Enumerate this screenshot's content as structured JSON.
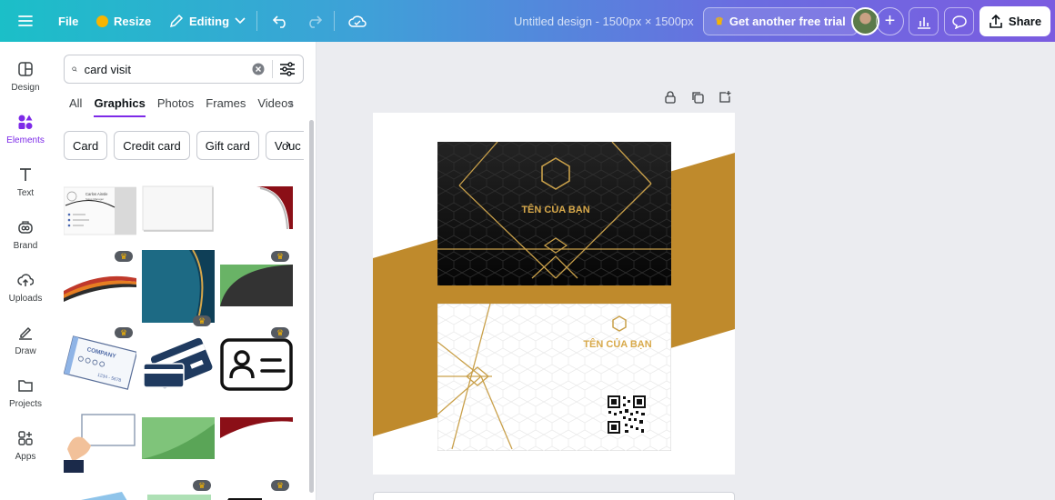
{
  "topbar": {
    "file_label": "File",
    "resize_label": "Resize",
    "editing_label": "Editing",
    "design_title": "Untitled design - 1500px × 1500px",
    "trial_label": "Get another free trial",
    "share_label": "Share"
  },
  "rail": {
    "items": [
      {
        "label": "Design"
      },
      {
        "label": "Elements"
      },
      {
        "label": "Text"
      },
      {
        "label": "Brand"
      },
      {
        "label": "Uploads"
      },
      {
        "label": "Draw"
      },
      {
        "label": "Projects"
      },
      {
        "label": "Apps"
      }
    ]
  },
  "panel": {
    "search_value": "card visit",
    "tabs": [
      "All",
      "Graphics",
      "Photos",
      "Frames",
      "Videos"
    ],
    "active_tab": "Graphics",
    "chips": [
      "Card",
      "Credit card",
      "Gift card",
      "Vouc"
    ],
    "tiles": {
      "tile1_name": "Carlos Ainsle",
      "tile1_role": "Sales Manager",
      "tile4_company": "COMPANY",
      "tile4_number": "1234 - 5678"
    }
  },
  "canvas": {
    "card_front_name": "TÊN CỦA BẠN",
    "card_back_name": "TÊN CỦA BẠN"
  },
  "colors": {
    "accent": "#7d2ae8",
    "gold": "#bf8a2c",
    "gold_text": "#d8a94a",
    "card_black": "#141414"
  }
}
